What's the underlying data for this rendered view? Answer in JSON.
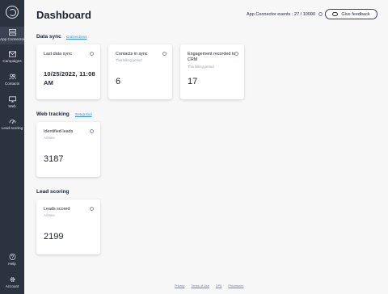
{
  "sidebar": {
    "items": [
      {
        "label": "App Connector",
        "icon": "app-connector-icon"
      },
      {
        "label": "Campaigns",
        "icon": "envelope-icon"
      },
      {
        "label": "Contacts",
        "icon": "people-icon"
      },
      {
        "label": "Web",
        "icon": "monitor-icon"
      },
      {
        "label": "Lead scoring",
        "icon": "lead-scoring-icon"
      }
    ],
    "bottom_items": [
      {
        "label": "Help",
        "icon": "question-icon"
      },
      {
        "label": "Account",
        "icon": "gear-icon"
      }
    ]
  },
  "header": {
    "title": "Dashboard",
    "events_label": "App Connector events : 27 / 10000",
    "feedback_label": "Give feedback"
  },
  "sections": {
    "data_sync": {
      "title": "Data sync",
      "link": "Connections",
      "cards": [
        {
          "title": "Last data sync",
          "subtitle": "",
          "value": "10/25/2022, 11:08 AM"
        },
        {
          "title": "Contacts in sync",
          "subtitle": "This billing period",
          "value": "6"
        },
        {
          "title": "Engagement recorded to CRM",
          "subtitle": "This billing period",
          "value": "17"
        }
      ]
    },
    "web_tracking": {
      "title": "Web tracking",
      "link": "Setup tool",
      "cards": [
        {
          "title": "Identified leads",
          "subtitle": "All time",
          "value": "3187"
        }
      ]
    },
    "lead_scoring": {
      "title": "Lead scoring",
      "cards": [
        {
          "title": "Leads scored",
          "subtitle": "All time",
          "value": "2199"
        }
      ]
    }
  },
  "footer": {
    "links": [
      "Privacy",
      "Terms of Use",
      "DPA",
      "Processors"
    ]
  },
  "colors": {
    "sidebar_bg": "#2b3240",
    "link": "#3b8ed0",
    "page_bg": "#f7f7f8"
  }
}
